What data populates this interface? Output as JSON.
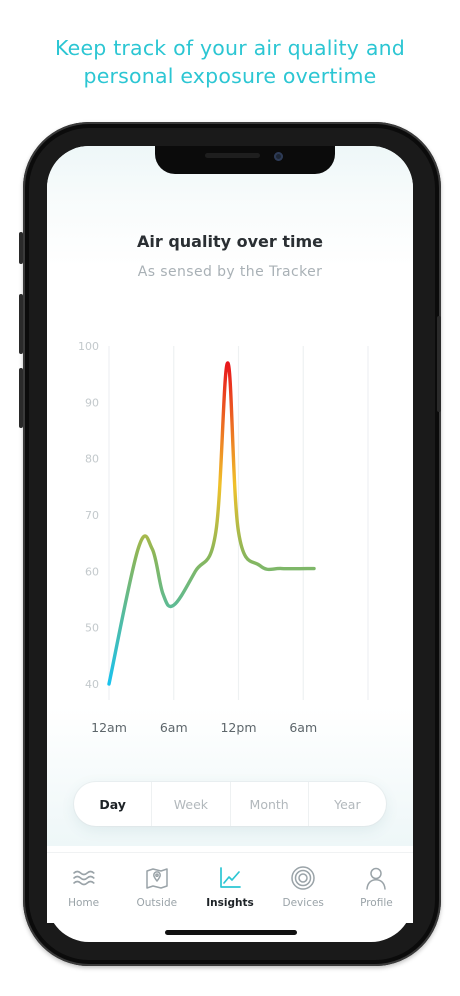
{
  "headline": {
    "line1": "Keep track of your air quality and",
    "line2": "personal exposure overtime"
  },
  "screen": {
    "title": "Air quality over time",
    "subtitle": "As sensed by the Tracker"
  },
  "chart_data": {
    "type": "line",
    "title": "Air quality over time",
    "subtitle": "As sensed by the Tracker",
    "x_tick_labels": [
      "12am",
      "6am",
      "12pm",
      "6am"
    ],
    "y_ticks": [
      40,
      50,
      60,
      70,
      80,
      90,
      100
    ],
    "ylim": [
      40,
      100
    ],
    "xlim": [
      0,
      24
    ],
    "grid": "vertical",
    "series": [
      {
        "x": [
          0,
          2.7,
          4,
          5.0,
          6.0,
          8.0,
          9.9,
          11.0,
          12.0,
          14.0,
          16.0,
          19.0
        ],
        "y": [
          40,
          64,
          64,
          56,
          54,
          60,
          67,
          97,
          67,
          61,
          60.5,
          60.5
        ]
      }
    ],
    "gradient_colors": [
      "#19c2ee",
      "#8ab65a",
      "#f0c12a",
      "#e8161c"
    ]
  },
  "segments": {
    "options": [
      "Day",
      "Week",
      "Month",
      "Year"
    ],
    "selected": "Day"
  },
  "tabs": [
    {
      "label": "Home",
      "icon": "waves-icon"
    },
    {
      "label": "Outside",
      "icon": "map-pin-icon"
    },
    {
      "label": "Insights",
      "icon": "chart-line-icon",
      "active": true
    },
    {
      "label": "Devices",
      "icon": "device-rings-icon"
    },
    {
      "label": "Profile",
      "icon": "person-icon"
    }
  ],
  "colors": {
    "headline": "#2cc6d3",
    "active_tab_icon": "#2cc6d3",
    "inactive_icon": "#9aa3a8"
  }
}
